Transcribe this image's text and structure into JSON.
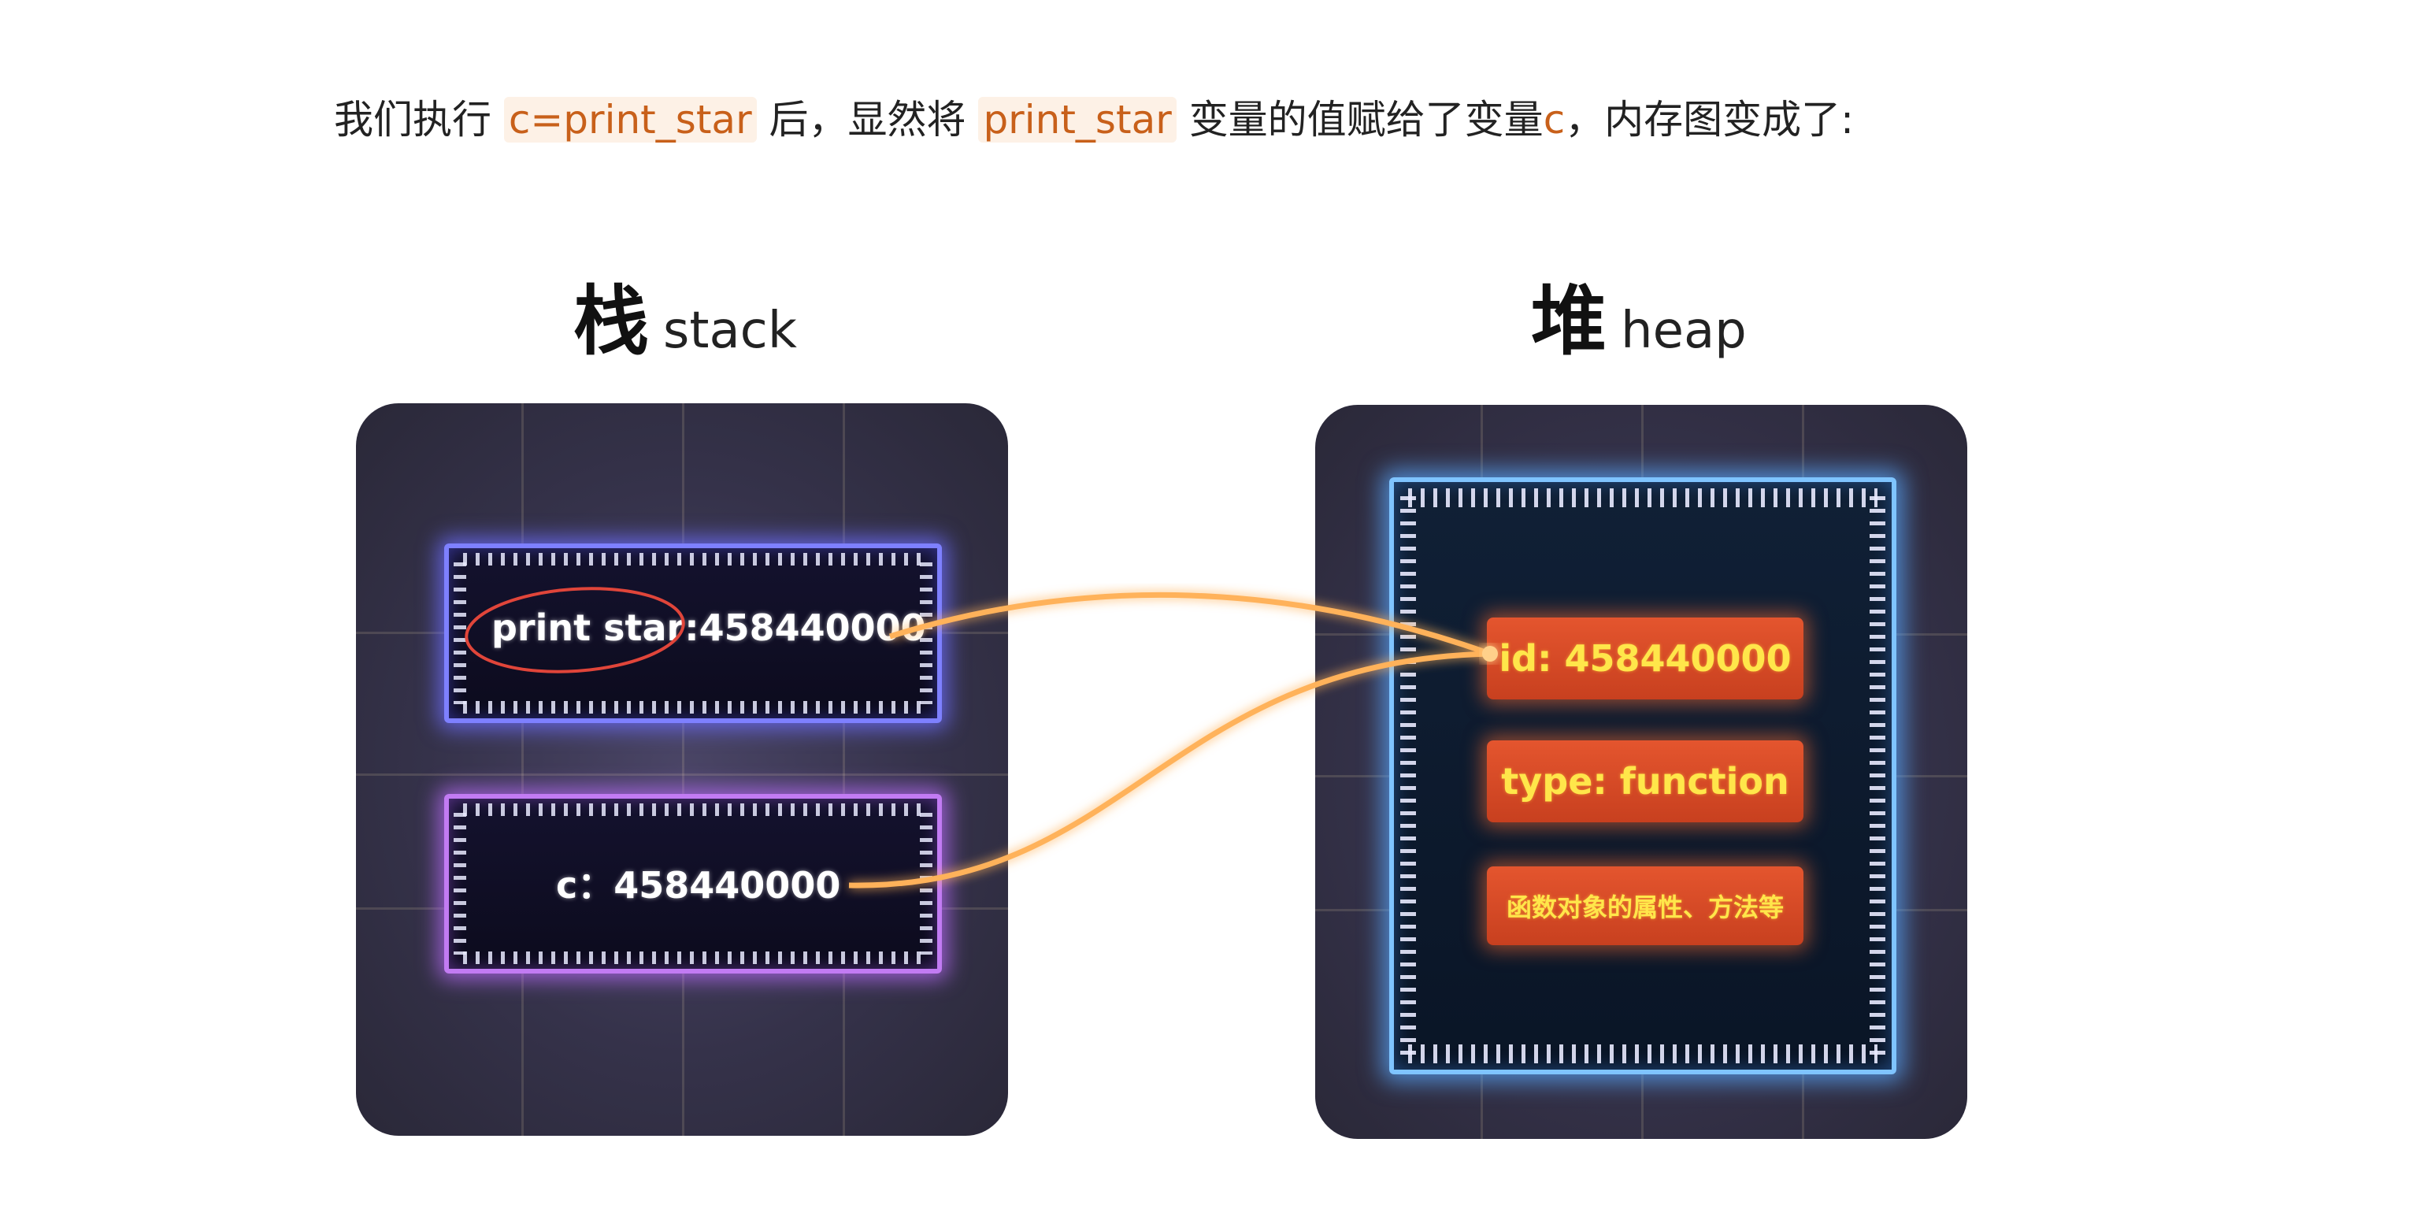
{
  "intro": {
    "prefix": "我们执行",
    "code1": "c=print_star",
    "middle": "后，显然将",
    "code2": "print_star",
    "suffix1": "变量的值赋给了变量",
    "code3": "c",
    "suffix2": "，内存图变成了:"
  },
  "stack": {
    "title_zh": "栈",
    "title_en": "stack",
    "cells": [
      "print star:458440000",
      "c：458440000"
    ]
  },
  "heap": {
    "title_zh": "堆",
    "title_en": "heap",
    "fields": [
      "id: 458440000",
      "type: function",
      "函数对象的属性、方法等"
    ]
  },
  "colors": {
    "code_text": "#c8601a",
    "arrow": "#ffb25a",
    "heap_text": "#ffe64a",
    "circle": "#e0453a"
  }
}
